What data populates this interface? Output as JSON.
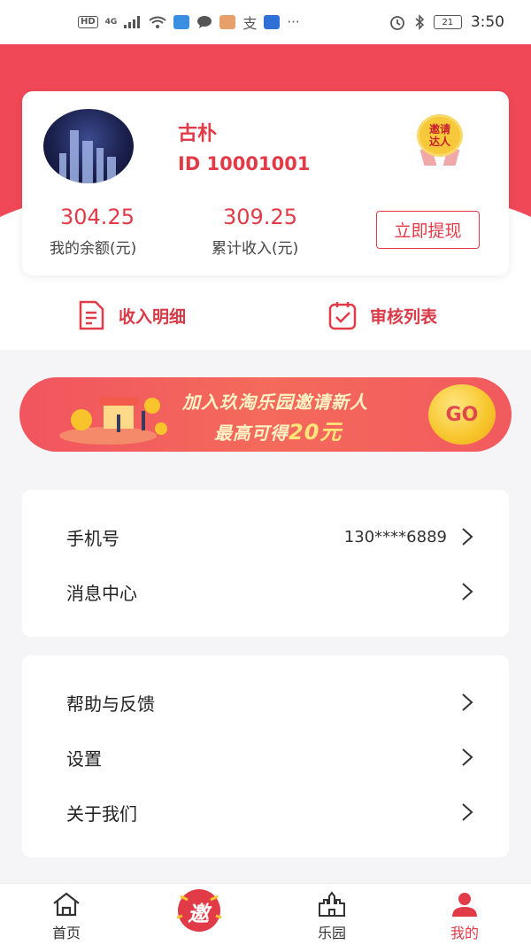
{
  "status_bar": {
    "hd": "HD",
    "net": "4G",
    "time": "3:50",
    "battery": "21",
    "more": "···"
  },
  "profile": {
    "name": "古朴",
    "id": "ID 10001001",
    "badge_line1": "邀请",
    "badge_line2": "达人",
    "balance_value": "304.25",
    "balance_label": "我的余额(元)",
    "income_value": "309.25",
    "income_label": "累计收入(元)",
    "withdraw_label": "立即提现"
  },
  "quick_links": {
    "income_detail": "收入明细",
    "review_list": "审核列表"
  },
  "banner": {
    "line1": "加入玖淘乐园邀请新人",
    "line2_prefix": "最高可得",
    "line2_amount": "20元",
    "go": "GO"
  },
  "menu_group_1": {
    "phone_label": "手机号",
    "phone_value": "130****6889",
    "messages_label": "消息中心"
  },
  "menu_group_2": {
    "help_label": "帮助与反馈",
    "settings_label": "设置",
    "about_label": "关于我们"
  },
  "tabbar": {
    "home": "首页",
    "invite": "邀",
    "park": "乐园",
    "mine": "我的"
  },
  "colors": {
    "brand": "#e23b48",
    "header": "#f04857",
    "gold": "#f7c52b"
  }
}
